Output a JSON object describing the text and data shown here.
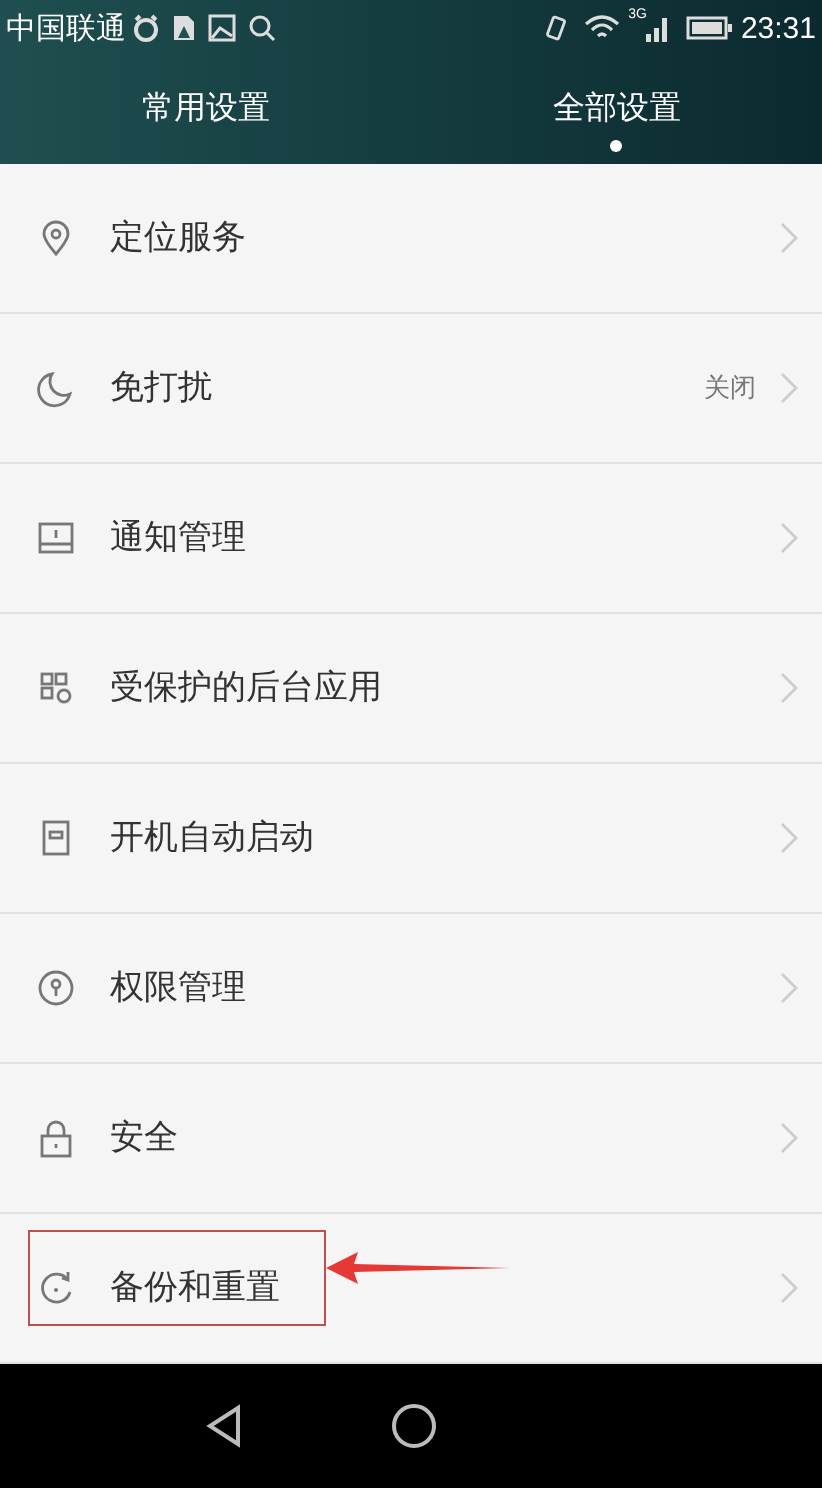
{
  "status_bar": {
    "carrier": "中国联通",
    "network": "3G",
    "time": "23:31"
  },
  "tabs": [
    {
      "label": "常用设置",
      "selected": false
    },
    {
      "label": "全部设置",
      "selected": true
    }
  ],
  "items": [
    {
      "kind": "location",
      "label": "定位服务",
      "annotated": false
    },
    {
      "kind": "moon",
      "label": "免打扰",
      "value": "关闭",
      "annotated": false
    },
    {
      "kind": "notification",
      "label": "通知管理",
      "annotated": false
    },
    {
      "kind": "apps",
      "label": "受保护的后台应用",
      "annotated": false
    },
    {
      "kind": "startup",
      "label": "开机自动启动",
      "annotated": false
    },
    {
      "kind": "permission",
      "label": "权限管理",
      "annotated": false
    },
    {
      "kind": "lock",
      "label": "安全",
      "annotated": false
    },
    {
      "kind": "backup",
      "label": "备份和重置",
      "annotated": true
    }
  ]
}
